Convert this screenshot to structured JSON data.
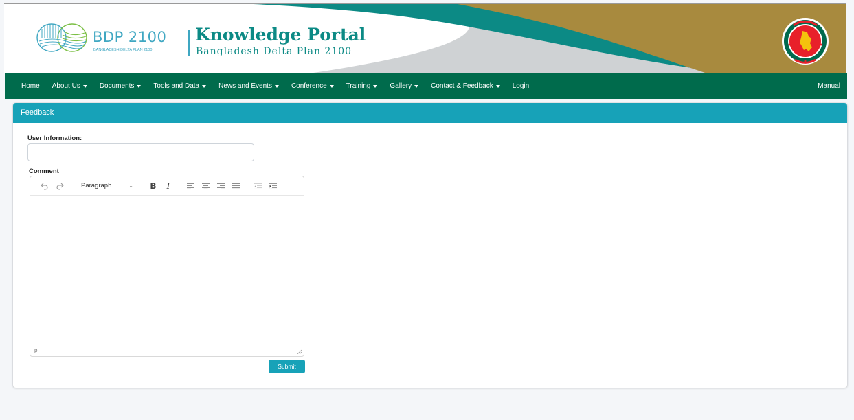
{
  "header": {
    "logo_title": "BDP 2100",
    "logo_subtitle": "BANGLADESH DELTA PLAN 2100",
    "portal_title": "Knowledge Portal",
    "portal_subtitle": "Bangladesh Delta Plan 2100",
    "emblem_icon": "government-emblem-icon"
  },
  "nav": {
    "items": [
      {
        "label": "Home",
        "dropdown": false
      },
      {
        "label": "About Us",
        "dropdown": true
      },
      {
        "label": "Documents",
        "dropdown": true
      },
      {
        "label": "Tools and Data",
        "dropdown": true
      },
      {
        "label": "News and Events",
        "dropdown": true
      },
      {
        "label": "Conference",
        "dropdown": true
      },
      {
        "label": "Training",
        "dropdown": true
      },
      {
        "label": "Gallery",
        "dropdown": true
      },
      {
        "label": "Contact & Feedback",
        "dropdown": true
      },
      {
        "label": "Login",
        "dropdown": false
      }
    ],
    "manual": "Manual"
  },
  "feedback": {
    "title": "Feedback",
    "user_label": "User Information:",
    "user_value": "",
    "comment_label": "Comment",
    "editor": {
      "block_format": "Paragraph",
      "status_path": "p"
    },
    "submit_label": "Submit"
  },
  "colors": {
    "nav_bg": "#006b4c",
    "header_teal": "#17a2b8",
    "banner_teal": "#0c8a85",
    "banner_gold": "#a88a3e"
  }
}
